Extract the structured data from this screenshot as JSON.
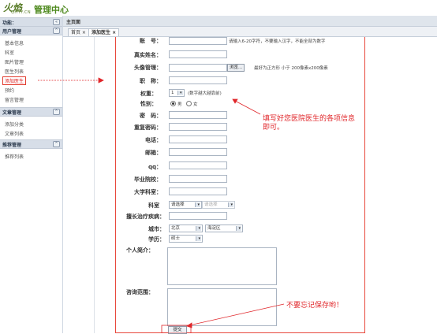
{
  "header": {
    "logo_mark": "火焰",
    "logo_sub": "QHYY.CN",
    "title": "管理中心"
  },
  "sidebar": {
    "head_label": "功能：",
    "sections": [
      {
        "title": "用户管理",
        "items": [
          "基本信息",
          "科室",
          "图片管理",
          "医生列表",
          "添加医生",
          "预约",
          "留言管理"
        ]
      },
      {
        "title": "文章管理",
        "items": [
          "添加分类",
          "文章列表"
        ]
      },
      {
        "title": "推荐管理",
        "items": [
          "推荐列表"
        ]
      }
    ]
  },
  "breadcrumb": "主页面",
  "tabs": [
    "首页 ×",
    "添加医生 ×"
  ],
  "form": {
    "account_label": "账　号：",
    "account_hint": "请输入6-20字符，不要输入汉字，不能全部为数字",
    "realname_label": "真实姓名：",
    "avatar_label": "头像管理：",
    "browse_label": "浏览...",
    "avatar_hint": "最好为正方形 小于 200像素x200像素",
    "title_label": "职　称：",
    "weight_label": "权重：",
    "weight_value": "1",
    "weight_hint": "(数字越大越靠前)",
    "gender_label": "性别：",
    "gender_options": [
      "男",
      "女"
    ],
    "password_label": "密　码：",
    "repassword_label": "重复密码：",
    "phone_label": "电话：",
    "email_label": "邮箱：",
    "qq_label": "qq：",
    "school_label": "毕业院校：",
    "university_label": "大学科室：",
    "dept_label": "科室",
    "dept_select": "请选择",
    "dept_sub_select": "请选择",
    "specialty_label": "擅长治疗疾病：",
    "city_label": "城市：",
    "city_value": "北京",
    "district_value": "海淀区",
    "education_label": "学历：",
    "education_value": "硕士",
    "intro_label": "个人简介：",
    "consult_label": "咨询范围：",
    "submit_label": "提交"
  },
  "annotations": {
    "fill_note": [
      "填写好您医院医生的各项信息",
      "即可。"
    ],
    "save_note": "不要忘记保存哟！"
  },
  "colors": {
    "accent_red": "#e0262a",
    "logo_green": "#4f8a1f"
  }
}
